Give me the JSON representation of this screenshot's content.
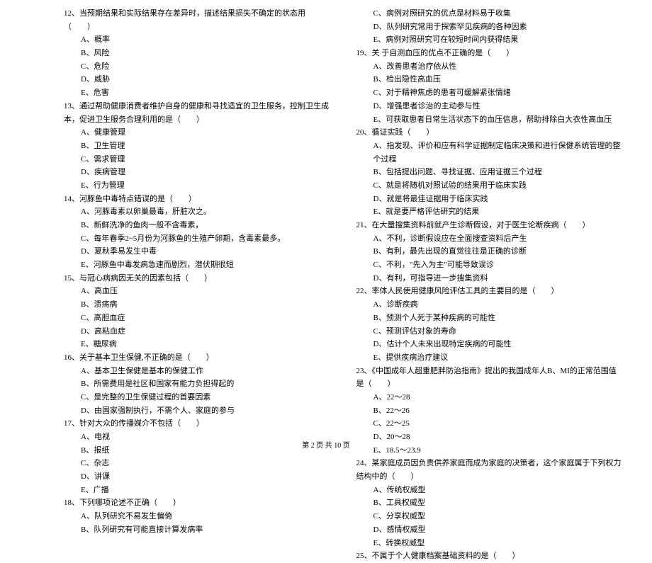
{
  "left": {
    "q12": {
      "text": "12、当预期结果和实际结果存在差异时，描述结果损失不确定的状态用（　　）",
      "options": [
        "A、概率",
        "B、风险",
        "C、危险",
        "D、威胁",
        "E、危害"
      ]
    },
    "q13": {
      "text": "13、通过帮助健康消费者维护自身的健康和寻找适宜的卫生服务，控制卫生成本，促进卫生服务合理利用的是（　　）",
      "options": [
        "A、健康管理",
        "B、卫生管理",
        "C、需求管理",
        "D、疾病管理",
        "E、行为管理"
      ]
    },
    "q14": {
      "text": "14、河豚鱼中毒特点错误的是（　　）",
      "options": [
        "A、河豚毒素以卵巢最毒，肝脏次之。",
        "B、新鲜洗净的鱼肉一般不含毒素，",
        "C、每年春季2~5月份为河豚鱼的生殖产卵期，含毒素最多。",
        "D、夏秋季易发生中毒",
        "E、河豚鱼中毒发病急速而剧烈，潜伏期很短"
      ]
    },
    "q15": {
      "text": "15、与冠心病病因无关的因素包括（　　）",
      "options": [
        "A、高血压",
        "B、溃疡病",
        "C、高胆血症",
        "D、高粘血症",
        "E、糖尿病"
      ]
    },
    "q16": {
      "text": "16、关于基本卫生保健,不正确的是（　　）",
      "options": [
        "A、基本卫生保健是基本的保健工作",
        "B、所需费用是社区和国家有能力负担得起的",
        "C、是完整的卫生保健过程的首要因素",
        "D、由国家强制执行，不需个人、家庭的参与"
      ]
    },
    "q17": {
      "text": "17、针对大众的传播媒介不包括（　　）",
      "options": [
        "A、电视",
        "B、报纸",
        "C、杂志",
        "D、讲课",
        "E、广播"
      ]
    },
    "q18": {
      "text": "18、下列哪项论述不正确（　　）",
      "options": [
        "A、队列研究不易发生偏倚",
        "B、队列研究有可能直接计算发病率"
      ]
    }
  },
  "right": {
    "q18_cont": {
      "options": [
        "C、病例对照研究的优点是材料易于收集",
        "D、队列研究常用于探索罕见疾病的各种因素",
        "E、病例对照研究可在较短时间内获得结果"
      ]
    },
    "q19": {
      "text": "19、关 于自测血压的优点不正确的是（　　）",
      "options": [
        "A、改善患者治疗依从性",
        "B、检出隐性高血压",
        "C、对于精神焦虑的患者可缓解紧张情绪",
        "D、增强患者诊治的主动参与性",
        "E、可获取患者日常生活状态下的血压信息，帮助排除白大衣性高血压"
      ]
    },
    "q20": {
      "text": "20、循证实践（　　）",
      "options": [
        "A、指发现、评价和应有科学证据制定临床决策和进行保健系统管理的整个过程",
        "B、包括提出问题、寻找证据、应用证据三个过程",
        "C、就是将随机对照试验的结果用于临床实践",
        "D、就是将最佳证据用于临床实践",
        "E、就是要严格评估研究的结果"
      ]
    },
    "q21": {
      "text": "21、在大量搜集资料前就产生诊断假设，对于医生论断疾病（　　）",
      "options": [
        "A、不利，诊断假设应在全面搜查资料后产生",
        "B、有利，最先出现的直觉往往是正确的诊断",
        "C、不利，\"先入为主\"可能导致误诊",
        "D、有利，可指导进一步搜集资料"
      ]
    },
    "q22": {
      "text": "22、率体人民使用健康风险评估工具的主要目的是（　　）",
      "options": [
        "A、诊断疾病",
        "B、预测个人死于某种疾病的可能性",
        "C、预测评估对象的寿命",
        "D、估计个人未来出现特定疾病的可能性",
        "E、提供疾病治疗建议"
      ]
    },
    "q23": {
      "text": "23、《中国成年人超重肥胖防治指南》提出的我国成年人B、MI的正常范围值是（　　）",
      "options": [
        "A、22～28",
        "B、22～26",
        "C、22～25",
        "D、20～28",
        "E、18.5～23.9"
      ]
    },
    "q24": {
      "text": "24、某家庭成员因负责供养家庭而成为家庭的决策者，这个家庭属于下列权力结构中的（　　）",
      "options": [
        "A、传统权威型",
        "B、工具权威型",
        "C、分享权威型",
        "D、感情权威型",
        "E、转换权威型"
      ]
    },
    "q25": {
      "text": "25、不属于个人健康档案基础资料的是（　　）"
    }
  },
  "footer": "第 2 页 共 10 页"
}
